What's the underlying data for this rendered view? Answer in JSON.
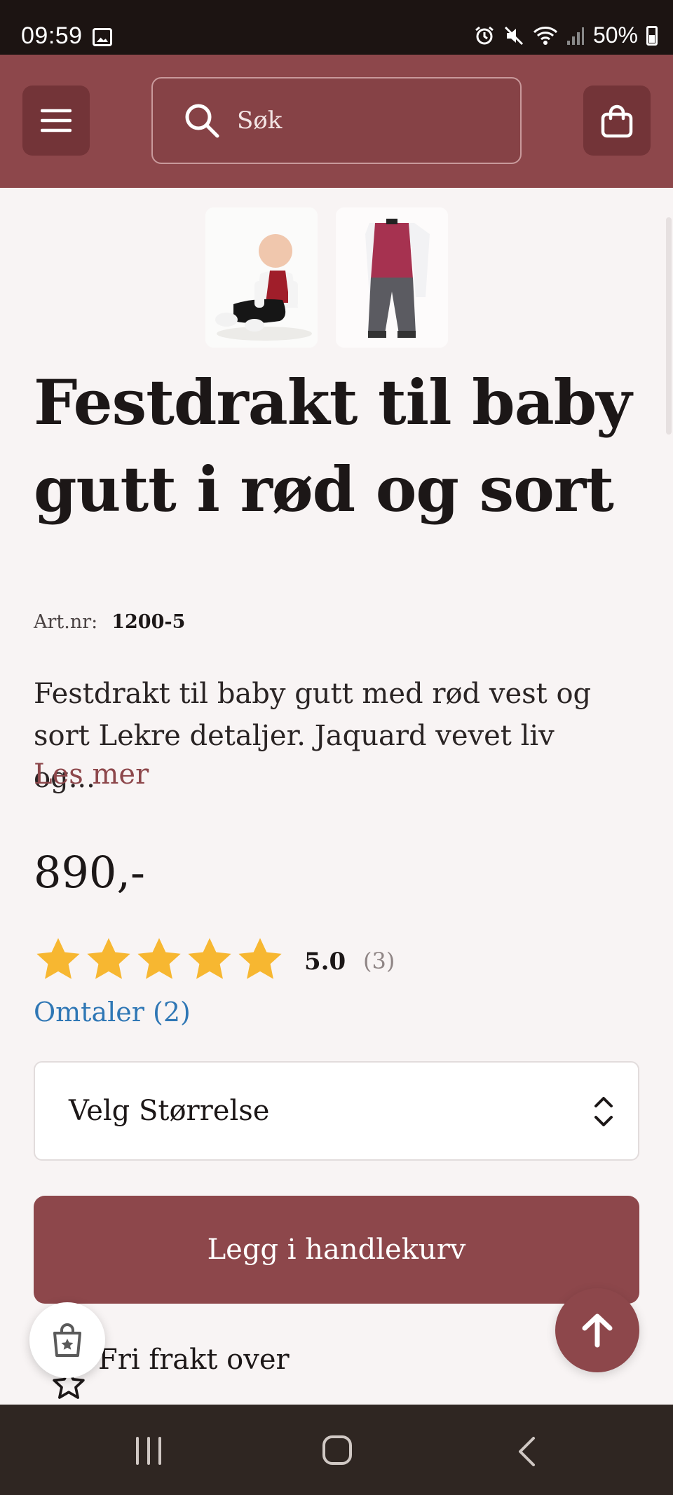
{
  "status_bar": {
    "time": "09:59",
    "battery": "50%",
    "icons": [
      "image-icon",
      "alarm-icon",
      "mute-icon",
      "wifi-icon",
      "signal-icon",
      "battery-icon"
    ]
  },
  "header": {
    "search": {
      "placeholder": "Søk"
    },
    "icons": [
      "menu-icon",
      "search-icon",
      "shopping-bag-icon"
    ],
    "colors": {
      "brand": "#8d474b",
      "button_bg": "#733438"
    }
  },
  "product": {
    "title": "Festdrakt til baby gutt i rød og sort",
    "artnr_label": "Art.nr:",
    "artnr_value": "1200-5",
    "description": "Festdrakt til baby gutt med rød vest og sort Lekre detaljer. Jaquard vevet liv og...",
    "read_more": "Les mer",
    "price": "890,-",
    "rating": {
      "value": "5.0",
      "count": "(3)",
      "stars": 5
    },
    "reviews_link": "Omtaler (2)",
    "size_select": {
      "label": "Velg Størrelse"
    },
    "add_to_cart": "Legg i handlekurv",
    "shipping_text": "Fri frakt over",
    "thumbnails": [
      "baby-photo-thumbnail",
      "outfit-photo-thumbnail"
    ]
  },
  "colors": {
    "star": "#f7b731",
    "link": "#2f77b5",
    "accent": "#8d474b"
  },
  "navigation": {
    "icons": [
      "recent-apps-icon",
      "home-icon",
      "back-icon"
    ]
  }
}
